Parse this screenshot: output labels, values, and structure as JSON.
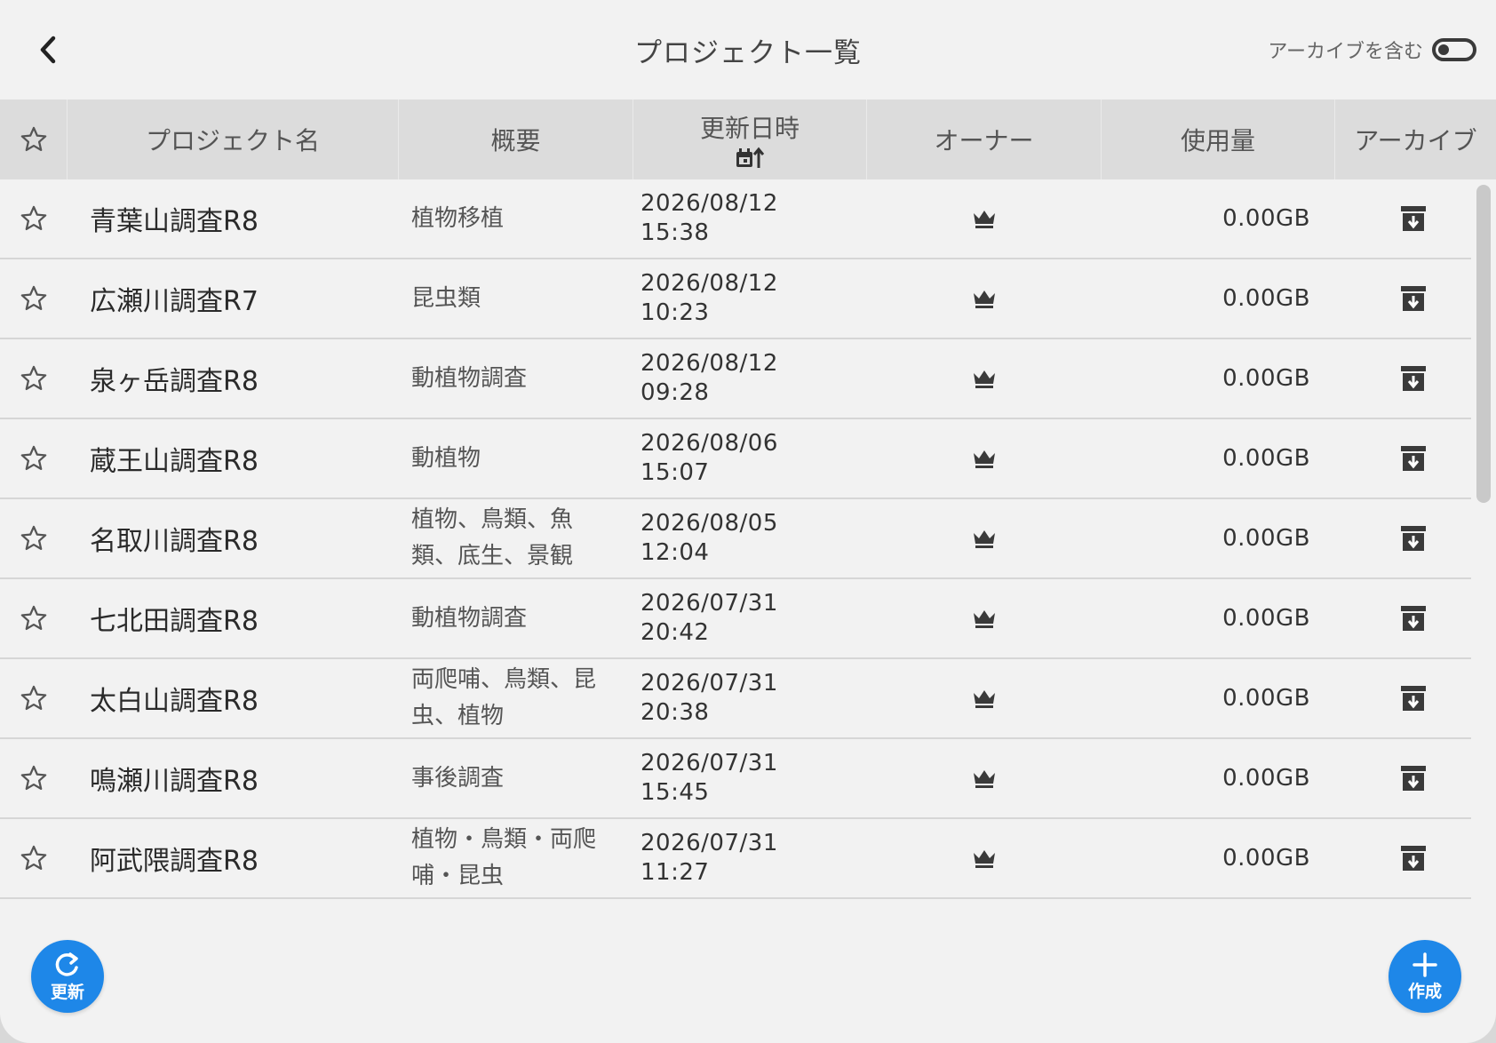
{
  "header": {
    "title": "プロジェクト一覧",
    "archive_toggle_label": "アーカイブを含む",
    "archive_toggle_on": false
  },
  "table": {
    "columns": {
      "name": "プロジェクト名",
      "desc": "概要",
      "date": "更新日時",
      "owner": "オーナー",
      "usage": "使用量",
      "archive": "アーカイブ"
    },
    "rows": [
      {
        "name": "青葉山調査R8",
        "desc": "植物移植",
        "date": "2026/08/12",
        "time": "15:38",
        "usage": "0.00GB"
      },
      {
        "name": "広瀬川調査R7",
        "desc": "昆虫類",
        "date": "2026/08/12",
        "time": "10:23",
        "usage": "0.00GB"
      },
      {
        "name": "泉ヶ岳調査R8",
        "desc": "動植物調査",
        "date": "2026/08/12",
        "time": "09:28",
        "usage": "0.00GB"
      },
      {
        "name": "蔵王山調査R8",
        "desc": "動植物",
        "date": "2026/08/06",
        "time": "15:07",
        "usage": "0.00GB"
      },
      {
        "name": "名取川調査R8",
        "desc": "植物、鳥類、魚類、底生、景観",
        "date": "2026/08/05",
        "time": "12:04",
        "usage": "0.00GB"
      },
      {
        "name": "七北田調査R8",
        "desc": "動植物調査",
        "date": "2026/07/31",
        "time": "20:42",
        "usage": "0.00GB"
      },
      {
        "name": "太白山調査R8",
        "desc": "両爬哺、鳥類、昆虫、植物",
        "date": "2026/07/31",
        "time": "20:38",
        "usage": "0.00GB"
      },
      {
        "name": "鳴瀬川調査R8",
        "desc": "事後調査",
        "date": "2026/07/31",
        "time": "15:45",
        "usage": "0.00GB"
      },
      {
        "name": "阿武隈調査R8",
        "desc": "植物・鳥類・両爬哺・昆虫",
        "date": "2026/07/31",
        "time": "11:27",
        "usage": "0.00GB"
      }
    ]
  },
  "buttons": {
    "refresh": "更新",
    "create": "作成"
  },
  "colors": {
    "accent": "#1e87e8",
    "background": "#f2f2f2",
    "header_bg": "#dcdcdc"
  },
  "icons": {
    "back": "chevron-left-icon",
    "star": "star-outline-icon",
    "owner": "crown-icon",
    "archive": "archive-box-icon",
    "sort": "calendar-sort-icon",
    "refresh": "refresh-icon",
    "create": "plus-icon"
  }
}
